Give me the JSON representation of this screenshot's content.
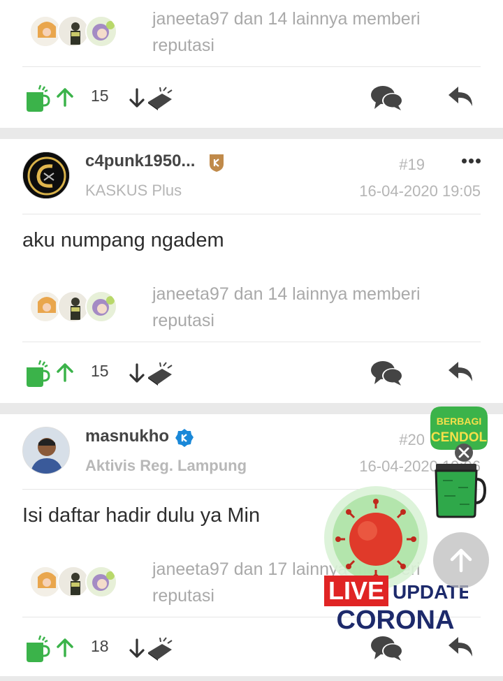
{
  "posts": [
    {
      "reputation_text": "janeeta97 dan 14 lainnya memberi reputasi",
      "up_count": "15"
    },
    {
      "username": "c4punk1950...",
      "user_title": "KASKUS Plus",
      "post_number": "#19",
      "date": "16-04-2020 19:05",
      "content": "aku numpang ngadem",
      "reputation_text": "janeeta97 dan 14 lainnya memberi reputasi",
      "up_count": "15"
    },
    {
      "username": "masnukho",
      "user_title": "Aktivis Reg. Lampung",
      "post_number": "#20",
      "date": "16-04-2020 19:06",
      "content": "Isi daftar hadir dulu ya Min",
      "reputation_text": "janeeta97 dan 17 lainnya memberi reputasi",
      "up_count": "18"
    }
  ],
  "widgets": {
    "cendol_label_1": "BERBAGI",
    "cendol_label_2": "CENDOL",
    "live_label": "LIVE",
    "update_label": "UPDATE",
    "corona_label": "CORONA"
  },
  "icons": {
    "cup": "cendol-cup-icon",
    "up": "arrow-up-icon",
    "down": "arrow-down-icon",
    "brick": "bata-icon",
    "comment": "comment-icon",
    "reply": "reply-icon"
  },
  "colors": {
    "green": "#3bb34a",
    "gray_text": "#a9a9a9",
    "red": "#e02424",
    "navy": "#1d2a6b"
  }
}
